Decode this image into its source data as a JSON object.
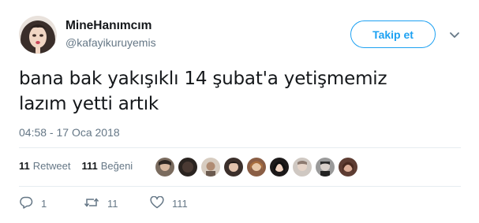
{
  "user": {
    "name": "MineHanımcım",
    "handle": "@kafayikuruyemis"
  },
  "follow_button": {
    "label": "Takip et"
  },
  "tweet": {
    "text_line1": "bana bak yakışıklı 14 şubat'a yetişmemiz",
    "text_line2": "lazım yetti artık",
    "timestamp": "04:58 - 17 Oca 2018"
  },
  "stats": {
    "retweet_count": "11",
    "retweet_label": "Retweet",
    "like_count": "111",
    "like_label": "Beğeni"
  },
  "actions": {
    "reply_count": "1",
    "retweet_count": "11",
    "like_count": "111"
  },
  "colors": {
    "accent": "#1da1f2",
    "secondary_text": "#657786",
    "primary_text": "#14171a",
    "divider": "#e6ecf0"
  },
  "icons": [
    "chevron-down-icon",
    "reply-icon",
    "retweet-icon",
    "heart-icon"
  ]
}
